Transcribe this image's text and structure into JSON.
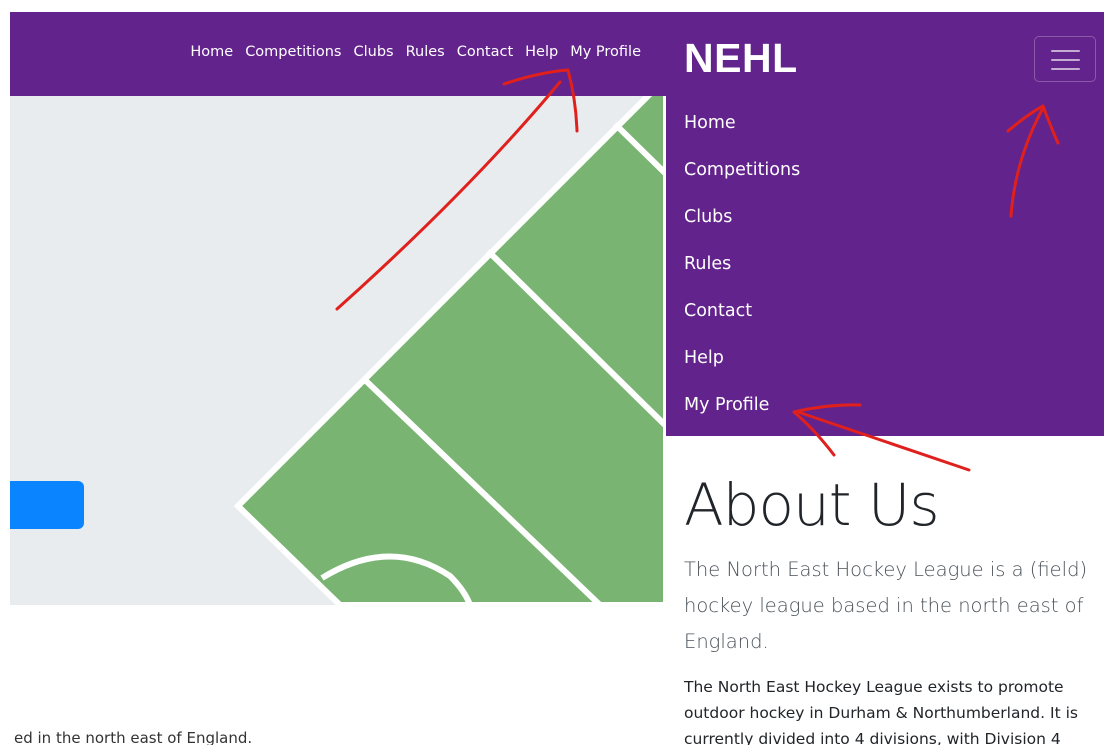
{
  "desktop": {
    "nav_items": [
      "Home",
      "Competitions",
      "Clubs",
      "Rules",
      "Contact",
      "Help",
      "My Profile"
    ],
    "footer_text": "ed in the north east of England."
  },
  "mobile": {
    "brand": "NEHL",
    "menu_items": [
      "Home",
      "Competitions",
      "Clubs",
      "Rules",
      "Contact",
      "Help",
      "My Profile"
    ],
    "about": {
      "title": "About Us",
      "lead": "The North East Hockey League is a (field) hockey league based in the north east of England.",
      "body": "The North East Hockey League exists to promote outdoor hockey in Durham & Northumberland. It is currently divided into 4 divisions, with Division 4"
    }
  },
  "colors": {
    "navbar": "#63238c",
    "pitch": "#79b472",
    "hero_bg": "#e9ecef",
    "button": "#0a84ff",
    "annotation": "#e0201c"
  },
  "icons": {
    "toggler": "hamburger-menu-icon"
  }
}
